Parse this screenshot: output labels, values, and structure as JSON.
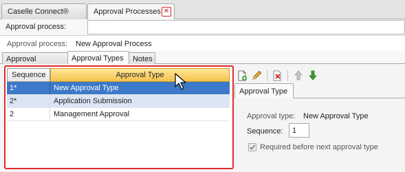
{
  "tabs": [
    {
      "label": "Caselle Connect®"
    },
    {
      "label": "Approval Processes"
    }
  ],
  "approval_process_field": {
    "label": "Approval process:",
    "value": ""
  },
  "info": {
    "label": "Approval process:",
    "value": "New Approval Process"
  },
  "sub_tabs": [
    {
      "label": "Approval Process"
    },
    {
      "label": "Approval Types"
    },
    {
      "label": "Notes"
    }
  ],
  "grid": {
    "headers": {
      "sequence": "Sequence",
      "type": "Approval Type"
    },
    "rows": [
      {
        "sequence": "1*",
        "type": "New Approval Type",
        "selected": true
      },
      {
        "sequence": "2*",
        "type": "Application Submission"
      },
      {
        "sequence": "2",
        "type": "Management Approval"
      }
    ]
  },
  "toolbar": [
    {
      "icon": "add-document-icon"
    },
    {
      "icon": "edit-pencil-icon"
    },
    {
      "icon": "delete-icon"
    },
    {
      "icon": "move-up-arrow-icon"
    },
    {
      "icon": "move-down-arrow-icon"
    }
  ],
  "detail": {
    "tab_label": "Approval Type",
    "type_label": "Approval type:",
    "type_value": "New Approval Type",
    "sequence_label": "Sequence:",
    "sequence_value": "1",
    "checkbox_label": "Required before next approval type",
    "checkbox_checked": true
  },
  "colors": {
    "highlight_border": "#e12b2b",
    "header_gold": "#f6c24a",
    "selection_blue": "#3c79c8"
  }
}
